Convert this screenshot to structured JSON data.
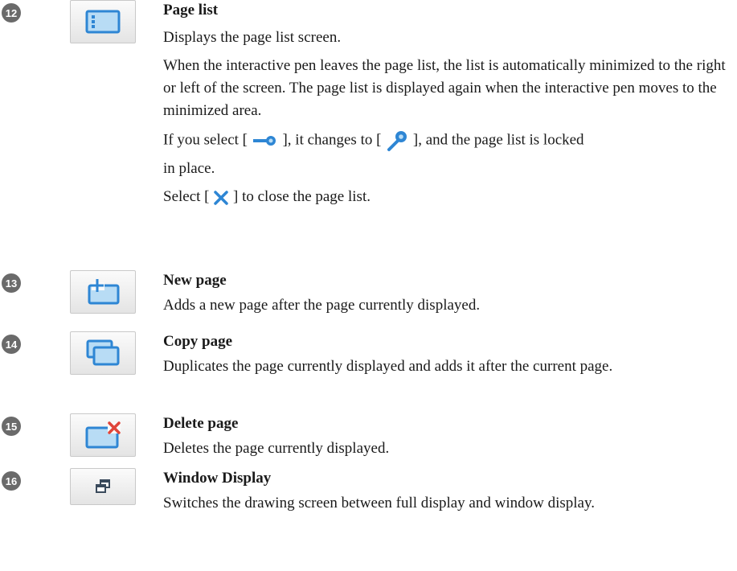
{
  "entries": [
    {
      "number": "12",
      "icon": "page-list-icon",
      "title": "Page list",
      "desc": "Displays the page list screen.",
      "para1": "When the interactive pen leaves the page list, the list is automatically minimized to the right or left of the screen. The page list is displayed again when the interactive pen moves to the minimized area.",
      "lock_p1": "If you select [",
      "lock_p2": "], it changes to [",
      "lock_p3": "], and the page list is locked",
      "lock_p4": "in place.",
      "close_p1": "Select [",
      "close_p2": "] to close the page list."
    },
    {
      "number": "13",
      "icon": "new-page-icon",
      "title": "New page",
      "desc": "Adds a new page after the page currently displayed."
    },
    {
      "number": "14",
      "icon": "copy-page-icon",
      "title": "Copy page",
      "desc": "Duplicates the page currently displayed and adds it after the current page."
    },
    {
      "number": "15",
      "icon": "delete-page-icon",
      "title": "Delete page",
      "desc": "Deletes the page currently displayed."
    },
    {
      "number": "16",
      "icon": "window-display-icon",
      "title": "Window Display",
      "desc": "Switches the drawing screen between full display and window display."
    }
  ],
  "colors": {
    "icon_blue": "#2e86d4",
    "icon_fill": "#b8dcf5",
    "delete_red": "#e0453a"
  }
}
